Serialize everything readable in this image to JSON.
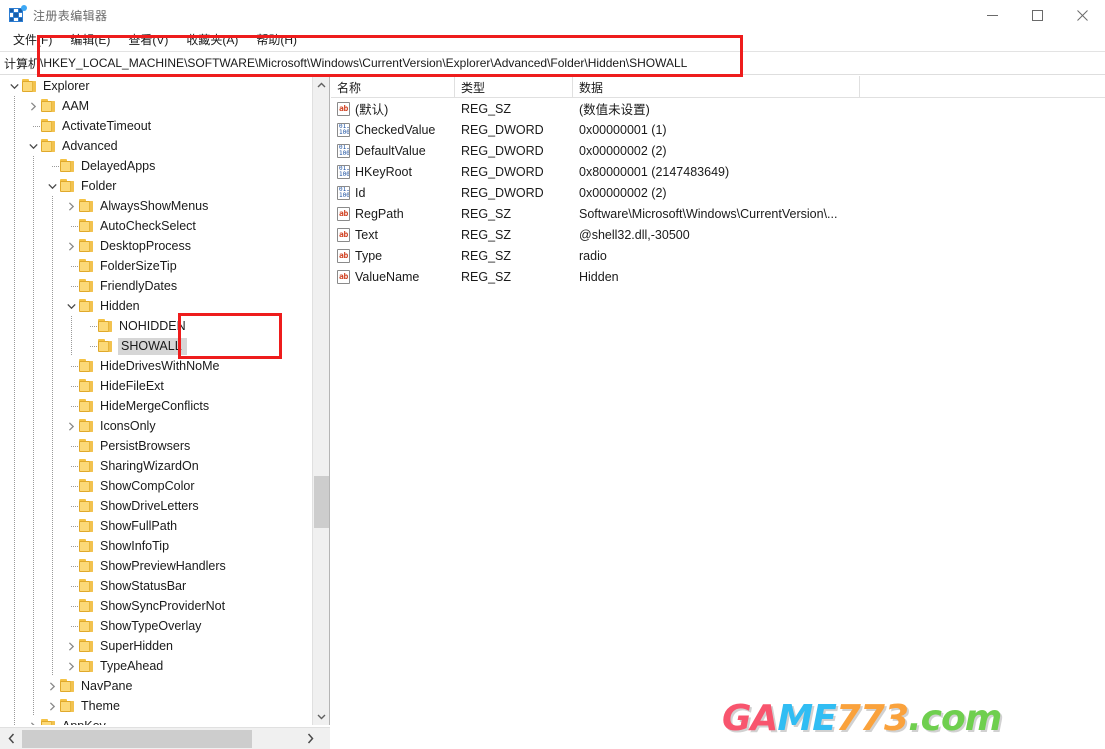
{
  "window": {
    "title": "注册表编辑器",
    "icon": "registry-editor-icon",
    "minimize_label": "最小化",
    "maximize_label": "最大化",
    "close_label": "关闭"
  },
  "menu": {
    "items": [
      {
        "label": "文件(F)"
      },
      {
        "label": "编辑(E)"
      },
      {
        "label": "查看(V)"
      },
      {
        "label": "收藏夹(A)"
      },
      {
        "label": "帮助(H)"
      }
    ]
  },
  "address": {
    "prefix": "计算机",
    "path": "\\HKEY_LOCAL_MACHINE\\SOFTWARE\\Microsoft\\Windows\\CurrentVersion\\Explorer\\Advanced\\Folder\\Hidden\\SHOWALL"
  },
  "tree": {
    "nodes": [
      {
        "label": "Explorer",
        "depth": 1,
        "expander": "expanded",
        "selected": false
      },
      {
        "label": "AAM",
        "depth": 2,
        "expander": "collapsed",
        "selected": false
      },
      {
        "label": "ActivateTimeout",
        "depth": 2,
        "expander": "none",
        "selected": false
      },
      {
        "label": "Advanced",
        "depth": 2,
        "expander": "expanded",
        "selected": false
      },
      {
        "label": "DelayedApps",
        "depth": 3,
        "expander": "none",
        "selected": false
      },
      {
        "label": "Folder",
        "depth": 3,
        "expander": "expanded",
        "selected": false
      },
      {
        "label": "AlwaysShowMenus",
        "depth": 4,
        "expander": "collapsed",
        "selected": false
      },
      {
        "label": "AutoCheckSelect",
        "depth": 4,
        "expander": "none",
        "selected": false
      },
      {
        "label": "DesktopProcess",
        "depth": 4,
        "expander": "collapsed",
        "selected": false
      },
      {
        "label": "FolderSizeTip",
        "depth": 4,
        "expander": "none",
        "selected": false
      },
      {
        "label": "FriendlyDates",
        "depth": 4,
        "expander": "none",
        "selected": false
      },
      {
        "label": "Hidden",
        "depth": 4,
        "expander": "expanded",
        "selected": false
      },
      {
        "label": "NOHIDDEN",
        "depth": 5,
        "expander": "none",
        "selected": false
      },
      {
        "label": "SHOWALL",
        "depth": 5,
        "expander": "none",
        "selected": true
      },
      {
        "label": "HideDrivesWithNoMe",
        "depth": 4,
        "expander": "none",
        "selected": false
      },
      {
        "label": "HideFileExt",
        "depth": 4,
        "expander": "none",
        "selected": false
      },
      {
        "label": "HideMergeConflicts",
        "depth": 4,
        "expander": "none",
        "selected": false
      },
      {
        "label": "IconsOnly",
        "depth": 4,
        "expander": "collapsed",
        "selected": false
      },
      {
        "label": "PersistBrowsers",
        "depth": 4,
        "expander": "none",
        "selected": false
      },
      {
        "label": "SharingWizardOn",
        "depth": 4,
        "expander": "none",
        "selected": false
      },
      {
        "label": "ShowCompColor",
        "depth": 4,
        "expander": "none",
        "selected": false
      },
      {
        "label": "ShowDriveLetters",
        "depth": 4,
        "expander": "none",
        "selected": false
      },
      {
        "label": "ShowFullPath",
        "depth": 4,
        "expander": "none",
        "selected": false
      },
      {
        "label": "ShowInfoTip",
        "depth": 4,
        "expander": "none",
        "selected": false
      },
      {
        "label": "ShowPreviewHandlers",
        "depth": 4,
        "expander": "none",
        "selected": false
      },
      {
        "label": "ShowStatusBar",
        "depth": 4,
        "expander": "none",
        "selected": false
      },
      {
        "label": "ShowSyncProviderNot",
        "depth": 4,
        "expander": "none",
        "selected": false
      },
      {
        "label": "ShowTypeOverlay",
        "depth": 4,
        "expander": "none",
        "selected": false
      },
      {
        "label": "SuperHidden",
        "depth": 4,
        "expander": "collapsed",
        "selected": false
      },
      {
        "label": "TypeAhead",
        "depth": 4,
        "expander": "collapsed",
        "selected": false
      },
      {
        "label": "NavPane",
        "depth": 3,
        "expander": "collapsed",
        "selected": false
      },
      {
        "label": "Theme",
        "depth": 3,
        "expander": "collapsed",
        "selected": false
      },
      {
        "label": "AppKey",
        "depth": 2,
        "expander": "collapsed",
        "selected": false
      }
    ]
  },
  "value_list": {
    "columns": [
      "名称",
      "类型",
      "数据"
    ],
    "rows": [
      {
        "icon": "string-value-icon",
        "kind": "sz",
        "name": "(默认)",
        "type": "REG_SZ",
        "data": "(数值未设置)"
      },
      {
        "icon": "dword-value-icon",
        "kind": "dword",
        "name": "CheckedValue",
        "type": "REG_DWORD",
        "data": "0x00000001 (1)"
      },
      {
        "icon": "dword-value-icon",
        "kind": "dword",
        "name": "DefaultValue",
        "type": "REG_DWORD",
        "data": "0x00000002 (2)"
      },
      {
        "icon": "dword-value-icon",
        "kind": "dword",
        "name": "HKeyRoot",
        "type": "REG_DWORD",
        "data": "0x80000001 (2147483649)"
      },
      {
        "icon": "dword-value-icon",
        "kind": "dword",
        "name": "Id",
        "type": "REG_DWORD",
        "data": "0x00000002 (2)"
      },
      {
        "icon": "string-value-icon",
        "kind": "sz",
        "name": "RegPath",
        "type": "REG_SZ",
        "data": "Software\\Microsoft\\Windows\\CurrentVersion\\..."
      },
      {
        "icon": "string-value-icon",
        "kind": "sz",
        "name": "Text",
        "type": "REG_SZ",
        "data": "@shell32.dll,-30500"
      },
      {
        "icon": "string-value-icon",
        "kind": "sz",
        "name": "Type",
        "type": "REG_SZ",
        "data": "radio"
      },
      {
        "icon": "string-value-icon",
        "kind": "sz",
        "name": "ValueName",
        "type": "REG_SZ",
        "data": "Hidden"
      }
    ]
  },
  "annotations": {
    "color": "#ee1c1c",
    "address_box_label": "注册表路径标注框",
    "showall_box_label": "SHOWALL 项标注框"
  },
  "watermark": {
    "parts": [
      {
        "text": "GA",
        "color": "#f8556e"
      },
      {
        "text": "ME",
        "color": "#31bdf3"
      },
      {
        "text": "773",
        "color": "#faa23c"
      },
      {
        "text": ".com",
        "color": "#6fcf4e"
      }
    ]
  }
}
